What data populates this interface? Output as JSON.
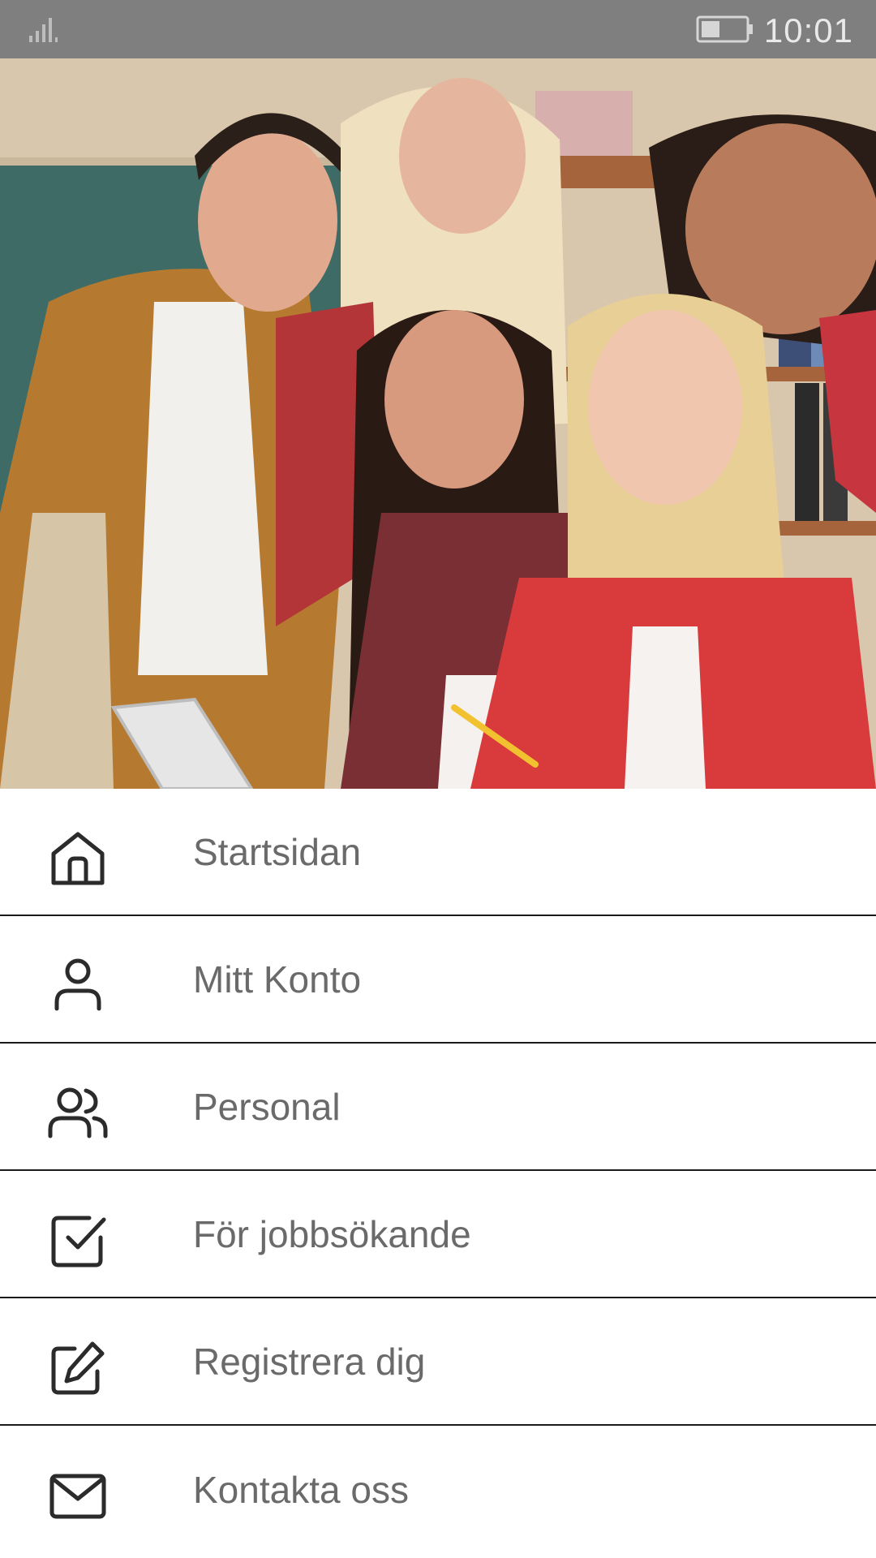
{
  "status_bar": {
    "time": "10:01",
    "signal_icon": "signal-icon",
    "battery_icon": "battery-icon"
  },
  "hero": {
    "image": "group-of-smiling-students-photo"
  },
  "menu": {
    "items": [
      {
        "label": "Startsidan",
        "icon": "home-icon"
      },
      {
        "label": "Mitt Konto",
        "icon": "user-icon"
      },
      {
        "label": "Personal",
        "icon": "users-icon"
      },
      {
        "label": "För jobbsökande",
        "icon": "checkbox-icon"
      },
      {
        "label": "Registrera dig",
        "icon": "edit-icon"
      },
      {
        "label": "Kontakta oss",
        "icon": "mail-icon"
      }
    ]
  },
  "colors": {
    "status_bar": "#7f7f7f",
    "menu_text": "#6a6a6a",
    "divider": "#1a1a1a",
    "icon": "#2b2b2b"
  }
}
